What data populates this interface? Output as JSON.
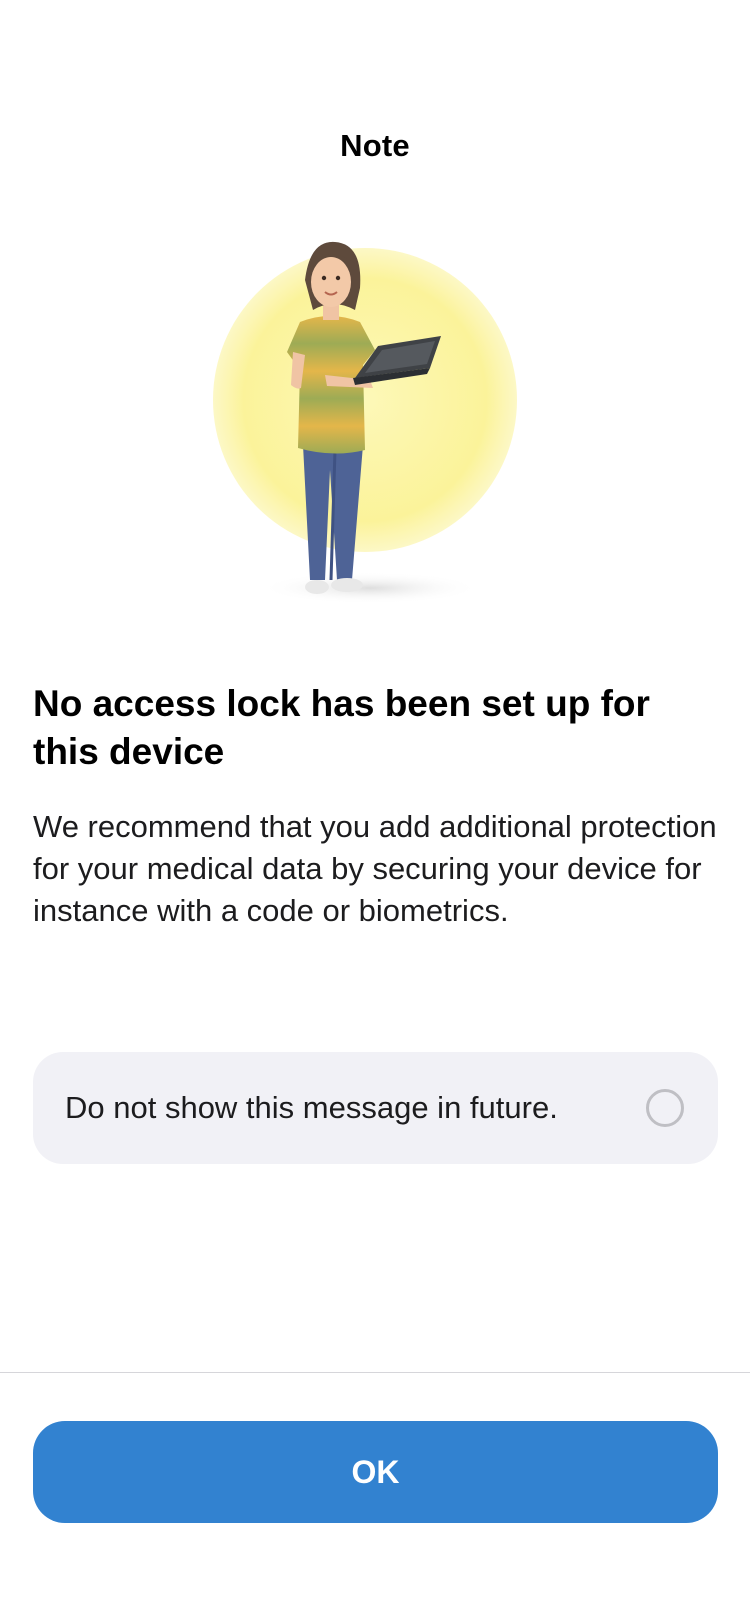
{
  "header": {
    "title": "Note"
  },
  "illustration": {
    "icon": "person-with-laptop-illustration",
    "accent_color": "#fbf39a"
  },
  "content": {
    "headline": "No access lock has been set up for this device",
    "body": "We recommend that you add additional protection for your medical data by securing your device for instance with a code or biometrics."
  },
  "option": {
    "label": "Do not show this message in future.",
    "checked": false
  },
  "footer": {
    "ok_label": "OK",
    "button_color": "#3282d0"
  }
}
